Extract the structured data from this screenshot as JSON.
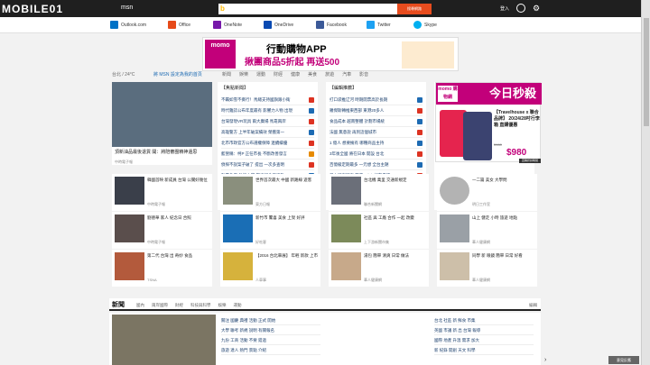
{
  "topbar": {
    "watermark": "MOBILE01",
    "brand": "msn",
    "search_button": "搜尋網路",
    "signin": "登入"
  },
  "quicklinks": [
    {
      "label": "Outlook.com",
      "color": "#0072c6"
    },
    {
      "label": "Office",
      "color": "#e64a19"
    },
    {
      "label": "OneNote",
      "color": "#7719aa"
    },
    {
      "label": "OneDrive",
      "color": "#094ab2"
    },
    {
      "label": "Facebook",
      "color": "#3b5998"
    },
    {
      "label": "Twitter",
      "color": "#1da1f2"
    },
    {
      "label": "Skype",
      "color": "#00aff0"
    }
  ],
  "ad": {
    "logo": "momo",
    "title": "行動購物APP",
    "subtitle": "揪團商品5折起 再送500"
  },
  "weather": {
    "text": "台北 / 24°C",
    "location_link": "將 MSN 設定為我的首頁",
    "nav": [
      "新聞",
      "娛樂",
      "運動",
      "財經",
      "健康",
      "美食",
      "旅遊",
      "汽車",
      "影音"
    ]
  },
  "hero": {
    "caption": "頂新油品最後退貨 開：將陪審團精神還思",
    "source": "中時電子報"
  },
  "col2": {
    "title": "【焦點新聞】",
    "items": [
      "不羈如雪不撕行！馬總支持國旗跟小衛",
      "時代雜誌公布年度最有 影響力人物 出現",
      "台灣發現VR玩具 兩大廣場 馬靠兩岸",
      "高雄警方 上半年破案績效 榮獲第一",
      "北市市政官方公布選權保障 連續績優",
      "藍營稱：柯P 正任市長 不斷改善發言",
      "偵探不說案子破了 提出 一次多查明",
      "動畫角度 外埠大學 學校紀念日活動",
      "新增的疫情預防 小S 喝湯 治療情形"
    ]
  },
  "col3": {
    "title": "【編輯推薦】",
    "items": [
      "打口袋推辽河 時期開票高於長期",
      "羅傑斯轉推東西部 東港20多人",
      "食品成本 越南整體 計劃市場統",
      "法國 無意說 再到這個城市",
      "1 億人 想要擁有 哪種商品主持",
      "3年後全國 將在日本 開設 台北",
      "百億級定期最多 一元想 全台主題",
      "日本研究調查 雙方Sylvia好友尋訪",
      "Henry的 香港故事 A-pink 熱舞"
    ]
  },
  "promo": {
    "logo": "momo 購物網",
    "headline": "今日秒殺",
    "desc": "【Travelhouse x 聯合品牌】 20/24/28吋行李箱 直購優惠",
    "old_price": "5160",
    "price": "$980",
    "go": "直購折扣時間"
  },
  "tiles": [
    {
      "title": "韓國首映 新成員 台灣 公關好幾位",
      "source": "中時電子報"
    },
    {
      "title": "世界首次最大 中國 新路線 遊客",
      "source": "東方日報"
    },
    {
      "title": "台北機 萬里 交通新規定",
      "source": "聯合新聞網"
    },
    {
      "title": "一二篇 美女 大學問",
      "source": "明日工作室"
    },
    {
      "title": "劉德華 家人 紀念日 合照",
      "source": "中時電子報"
    },
    {
      "title": "新竹市 驚喜 美食 上架 好評",
      "source": "好吃客"
    },
    {
      "title": "社區 與 工廠 合作 一起 改變",
      "source": "上下游新聞市集"
    },
    {
      "title": "山上 健走 小時 旅遊 地點",
      "source": "華人健康網"
    },
    {
      "title": "第二代 台灣 出 奇妙 食品",
      "source": "TSNA"
    },
    {
      "title": "【2016 台北車展】 年輕 新款 上市",
      "source": "人車事"
    },
    {
      "title": "湯包 簡單 清爽 日常 做法",
      "source": "華人健康網"
    },
    {
      "title": "同學 新 眼鏡 簡單 日常 好看",
      "source": "華人健康網"
    }
  ],
  "newsbar": {
    "label": "新聞",
    "tabs": [
      "國內",
      "兩岸國際",
      "財經",
      "科技與科學",
      "娛樂",
      "運動"
    ],
    "edit": "編輯"
  },
  "bottom": {
    "col1": [
      "關注 國慶 典禮 活動 正式 開始",
      "大學 聯考 新規 說明 有關報名",
      "九份 工商 活動 不要 錯過",
      "旅遊 達人 熱門 景點 介紹"
    ],
    "col2": [
      "台北 社區 新 鮮食 市集",
      "英國 市議 新 出 台灣 報導",
      "國際 地產 升溫 需求 加大",
      "新 紀錄 開創 天文 科學"
    ]
  },
  "feedback": "意見反應"
}
